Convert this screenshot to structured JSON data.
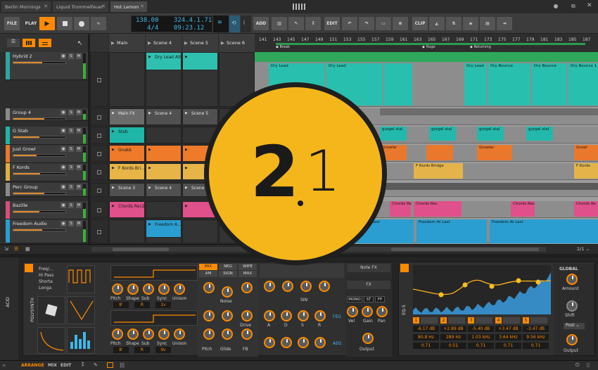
{
  "tabs": [
    {
      "label": "Berlin Mornings"
    },
    {
      "label": "Liquid Trommelfeuer"
    },
    {
      "label": "Hot Lemon"
    }
  ],
  "toolbar": {
    "file": "FILE",
    "play": "PLAY",
    "add": "ADD",
    "edit": "EDIT",
    "clip": "CLIP"
  },
  "transport": {
    "tempo": "138.00",
    "position": "324.4.1.71",
    "signature": "4/4",
    "time": "09:23.12"
  },
  "tracks": [
    {
      "name": "Hybrid 2",
      "color": "#2fa6a0",
      "fader": 0.55
    },
    {
      "name": "Group 4",
      "color": "#8a8a8a",
      "fader": 0.6
    },
    {
      "name": "G Stab",
      "color": "#1fb6a8",
      "fader": 0.5
    },
    {
      "name": "Just Growl",
      "color": "#e8782a",
      "fader": 0.45
    },
    {
      "name": "F Kords",
      "color": "#e0b040",
      "fader": 0.52
    },
    {
      "name": "Perc Group",
      "color": "#8a8a8a",
      "fader": 0.6
    },
    {
      "name": "Bazille",
      "color": "#d94c7c",
      "fader": 0.5
    },
    {
      "name": "Freedom Audio",
      "color": "#2a9ed0",
      "fader": 0.55
    }
  ],
  "scenes": [
    "Main",
    "Scene 4",
    "Scene 5",
    "Scene 6"
  ],
  "launcher_clips": {
    "hybrid": "Dry Lead Alt",
    "group_main_fx": "Main FX",
    "group_scene4": "Scene 4",
    "group_scene5": "Scene 5",
    "gstab": "Stab",
    "growl": "Gnakk",
    "fkords": "F Kords Bri...",
    "perc_scene3": "Scene 3",
    "perc_scene4": "Scene 4",
    "perc_scene5": "Scene",
    "bazille": "Chords Rec2",
    "freedom": "Freedom A..."
  },
  "ruler": [
    "141",
    "143",
    "145",
    "147",
    "149",
    "151",
    "153",
    "155",
    "157",
    "159",
    "161",
    "163",
    "165",
    "167",
    "169",
    "171",
    "173",
    "175",
    "177",
    "179",
    "181",
    "183",
    "185",
    "187"
  ],
  "cue_markers": [
    "Break",
    "Huge",
    "Returning"
  ],
  "arr_clips": {
    "drylead": [
      "Dry Lead",
      "Dry Lead",
      "Dry Lead"
    ],
    "drybounce": [
      "Dry Bounce",
      "Dry Bounce",
      "Dry Bounce 1"
    ],
    "gurgel": [
      "gurgel stal",
      "gurgel stal",
      "gurgel stal",
      "gurgel stal"
    ],
    "growler": [
      "Growler",
      "Growler",
      "Growl"
    ],
    "fkords": [
      "F Kords Bridge",
      "F Kords"
    ],
    "chords": [
      "Chords Re",
      "Chords Rec",
      "Chords Rec",
      "Chords Re"
    ],
    "freedom": [
      "Freedom At Last",
      "Freedom At Last",
      "Freedom At Last"
    ]
  },
  "zoom": "2/1",
  "version": {
    "major": "2",
    "minor": "1"
  },
  "devices": {
    "acid": "ACID",
    "polysynth": "POLYSYNTH",
    "filter_modes": [
      "Freq/...",
      "Hi Pass",
      "Shorta",
      "Longa"
    ],
    "osc_knobs": [
      "Pitch",
      "Shape",
      "Sub",
      "Sync",
      "Unison"
    ],
    "osc_values": [
      "8'",
      "R",
      "1v",
      "8'",
      "R",
      "9v"
    ],
    "mixer_tabs": [
      "MIX",
      "NEG",
      "WIPE",
      "AM",
      "SIGN",
      "MAX"
    ],
    "mixer_labels": [
      "Noise",
      "Drive",
      "Pitch",
      "Glide",
      "FB"
    ],
    "env_labels": [
      "A",
      "D",
      "S",
      "R"
    ],
    "sin_label": "SIN",
    "feg": "FEG",
    "aeg": "AEG",
    "note_fx": "Note FX",
    "fx": "FX",
    "mono": "MONO",
    "st": "ST",
    "fp": "FP",
    "out_labels": [
      "Vel",
      "Gain",
      "Pan"
    ],
    "output": "Output",
    "eq": "EQ-5",
    "eq_bands": [
      {
        "n": "1",
        "gain": "-6.17 dB",
        "freq": "80.8 Hz",
        "q": "0.71"
      },
      {
        "n": "2",
        "gain": "+2.89 dB",
        "freq": "289 Hz",
        "q": "0.51"
      },
      {
        "n": "3",
        "gain": "-5.40 dB",
        "freq": "1.03 kHz",
        "q": "0.71"
      },
      {
        "n": "4",
        "gain": "+3.47 dB",
        "freq": "3.64 kHz",
        "q": "0.71"
      },
      {
        "n": "5",
        "gain": "-3.47 dB",
        "freq": "9.56 kHz",
        "q": "0.71"
      }
    ],
    "global": "GLOBAL",
    "amount": "Amount",
    "shift": "Shift",
    "post": "Post",
    "out2": "Output"
  },
  "footer": {
    "arrange": "ARRANGE",
    "mix": "MIX",
    "edit": "EDIT"
  }
}
